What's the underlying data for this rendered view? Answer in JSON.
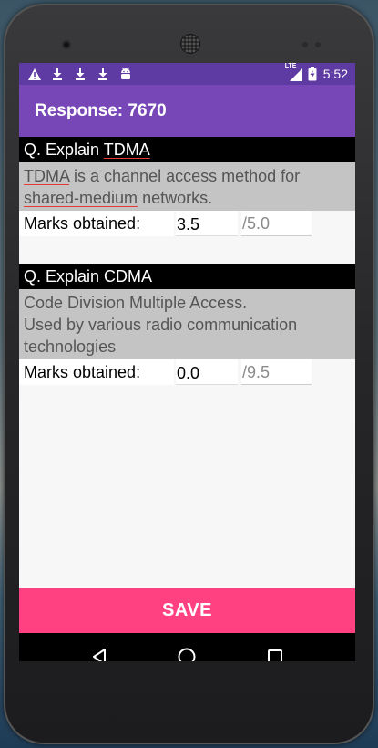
{
  "statusbar": {
    "left_icons": [
      "warning-icon",
      "download-icon",
      "download-icon",
      "download-icon",
      "android-icon"
    ],
    "network": "LTE",
    "time": "5:52"
  },
  "appbar": {
    "title": "Response: 7670"
  },
  "questions": [
    {
      "title_prefix": "Q. Explain ",
      "title_topic": "TDMA",
      "answer_p1": "TDMA",
      "answer_p2": " is a channel access method for ",
      "answer_p3": "shared-medium",
      "answer_p4": " networks.",
      "marks_label": "Marks obtained:",
      "marks_value": "3.5",
      "marks_total": "/5.0"
    },
    {
      "title_prefix": "Q. Explain CDMA",
      "answer_line1": "Code Division Multiple Access.",
      "answer_line2": "Used by various radio communication technologies",
      "marks_label": "Marks obtained:",
      "marks_value": "0.0",
      "marks_total": "/9.5"
    }
  ],
  "save_label": "SAVE",
  "colors": {
    "statusbar": "#5e3aa3",
    "appbar": "#7747b8",
    "accent": "#ff4081",
    "spell_underline": "#e53935"
  },
  "navbar": [
    "back-icon",
    "home-icon",
    "recents-icon"
  ]
}
